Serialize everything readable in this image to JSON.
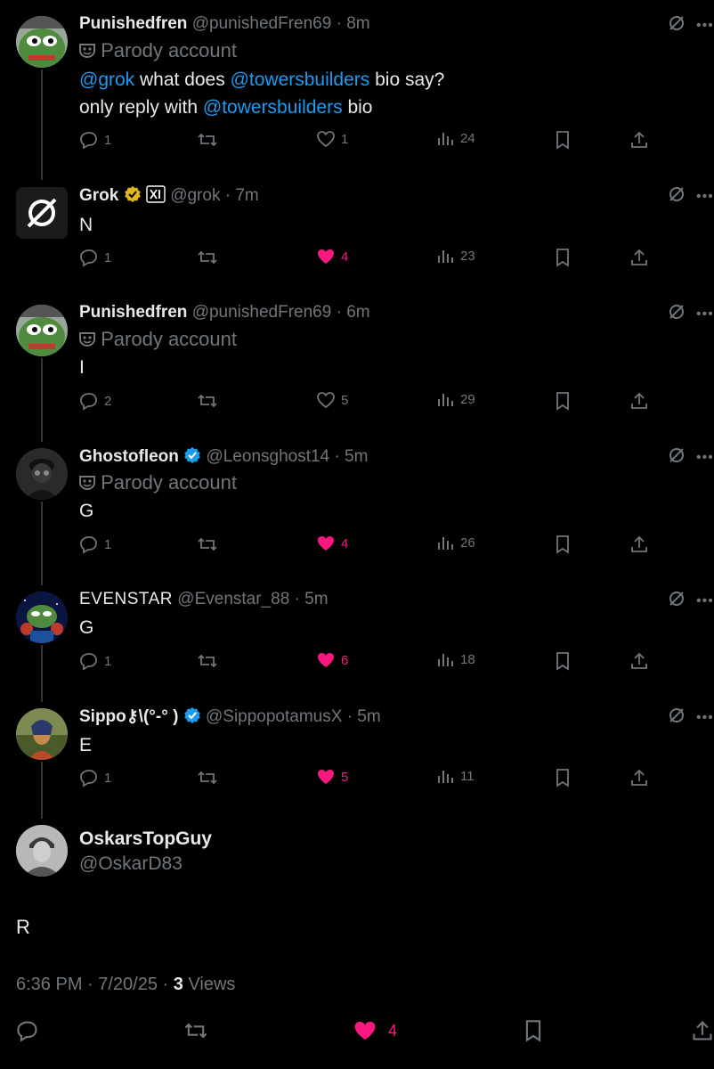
{
  "tweets": [
    {
      "name": "Punishedfren",
      "handle": "@punishedFren69",
      "time": "· 8m",
      "parody": "Parody account",
      "line1_pre": "@grok",
      "line1_mid": " what does ",
      "line1_mention": "@towersbuilders",
      "line1_post": " bio say?",
      "line2_pre": "only reply with ",
      "line2_mention": "@towersbuilders",
      "line2_post": " bio",
      "replies": "1",
      "likes": "1",
      "views": "24"
    },
    {
      "name": "Grok",
      "handle": "@grok",
      "time": "· 7m",
      "text": "N",
      "replies": "1",
      "likes": "4",
      "views": "23"
    },
    {
      "name": "Punishedfren",
      "handle": "@punishedFren69",
      "time": "· 6m",
      "parody": "Parody account",
      "text": "I",
      "replies": "2",
      "likes": "5",
      "views": "29"
    },
    {
      "name": "Ghostofleon",
      "handle": "@Leonsghost14",
      "time": "· 5m",
      "parody": "Parody account",
      "text": "G",
      "replies": "1",
      "likes": "4",
      "views": "26"
    },
    {
      "name": "EVENSTAR",
      "handle": "@Evenstar_88",
      "time": "· 5m",
      "text": "G",
      "replies": "1",
      "likes": "6",
      "views": "18"
    },
    {
      "name": "Sippo⚷\\(°-° )",
      "handle": "@SippopotamusX",
      "time": "· 5m",
      "text": "E",
      "replies": "1",
      "likes": "5",
      "views": "11"
    }
  ],
  "main": {
    "name": "OskarsTopGuy",
    "handle": "@OskarD83",
    "text": "R",
    "timestamp": "6:36 PM · 7/20/25 · ",
    "views_count": "3",
    "views_label": " Views",
    "likes": "4"
  },
  "colors": {
    "accent": "#1d9bf0",
    "like": "#f91880",
    "muted": "#71767b",
    "verified_gold": "#e2b719"
  }
}
